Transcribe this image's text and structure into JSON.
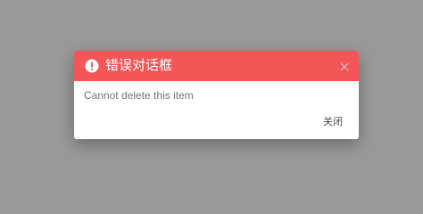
{
  "dialog": {
    "title": "错误对话框",
    "message": "Cannot delete this item",
    "close_button_label": "关闭",
    "header_color": "#f45557",
    "icons": {
      "title_icon": "exclamation-circle-icon",
      "dismiss_icon": "close-icon"
    }
  }
}
